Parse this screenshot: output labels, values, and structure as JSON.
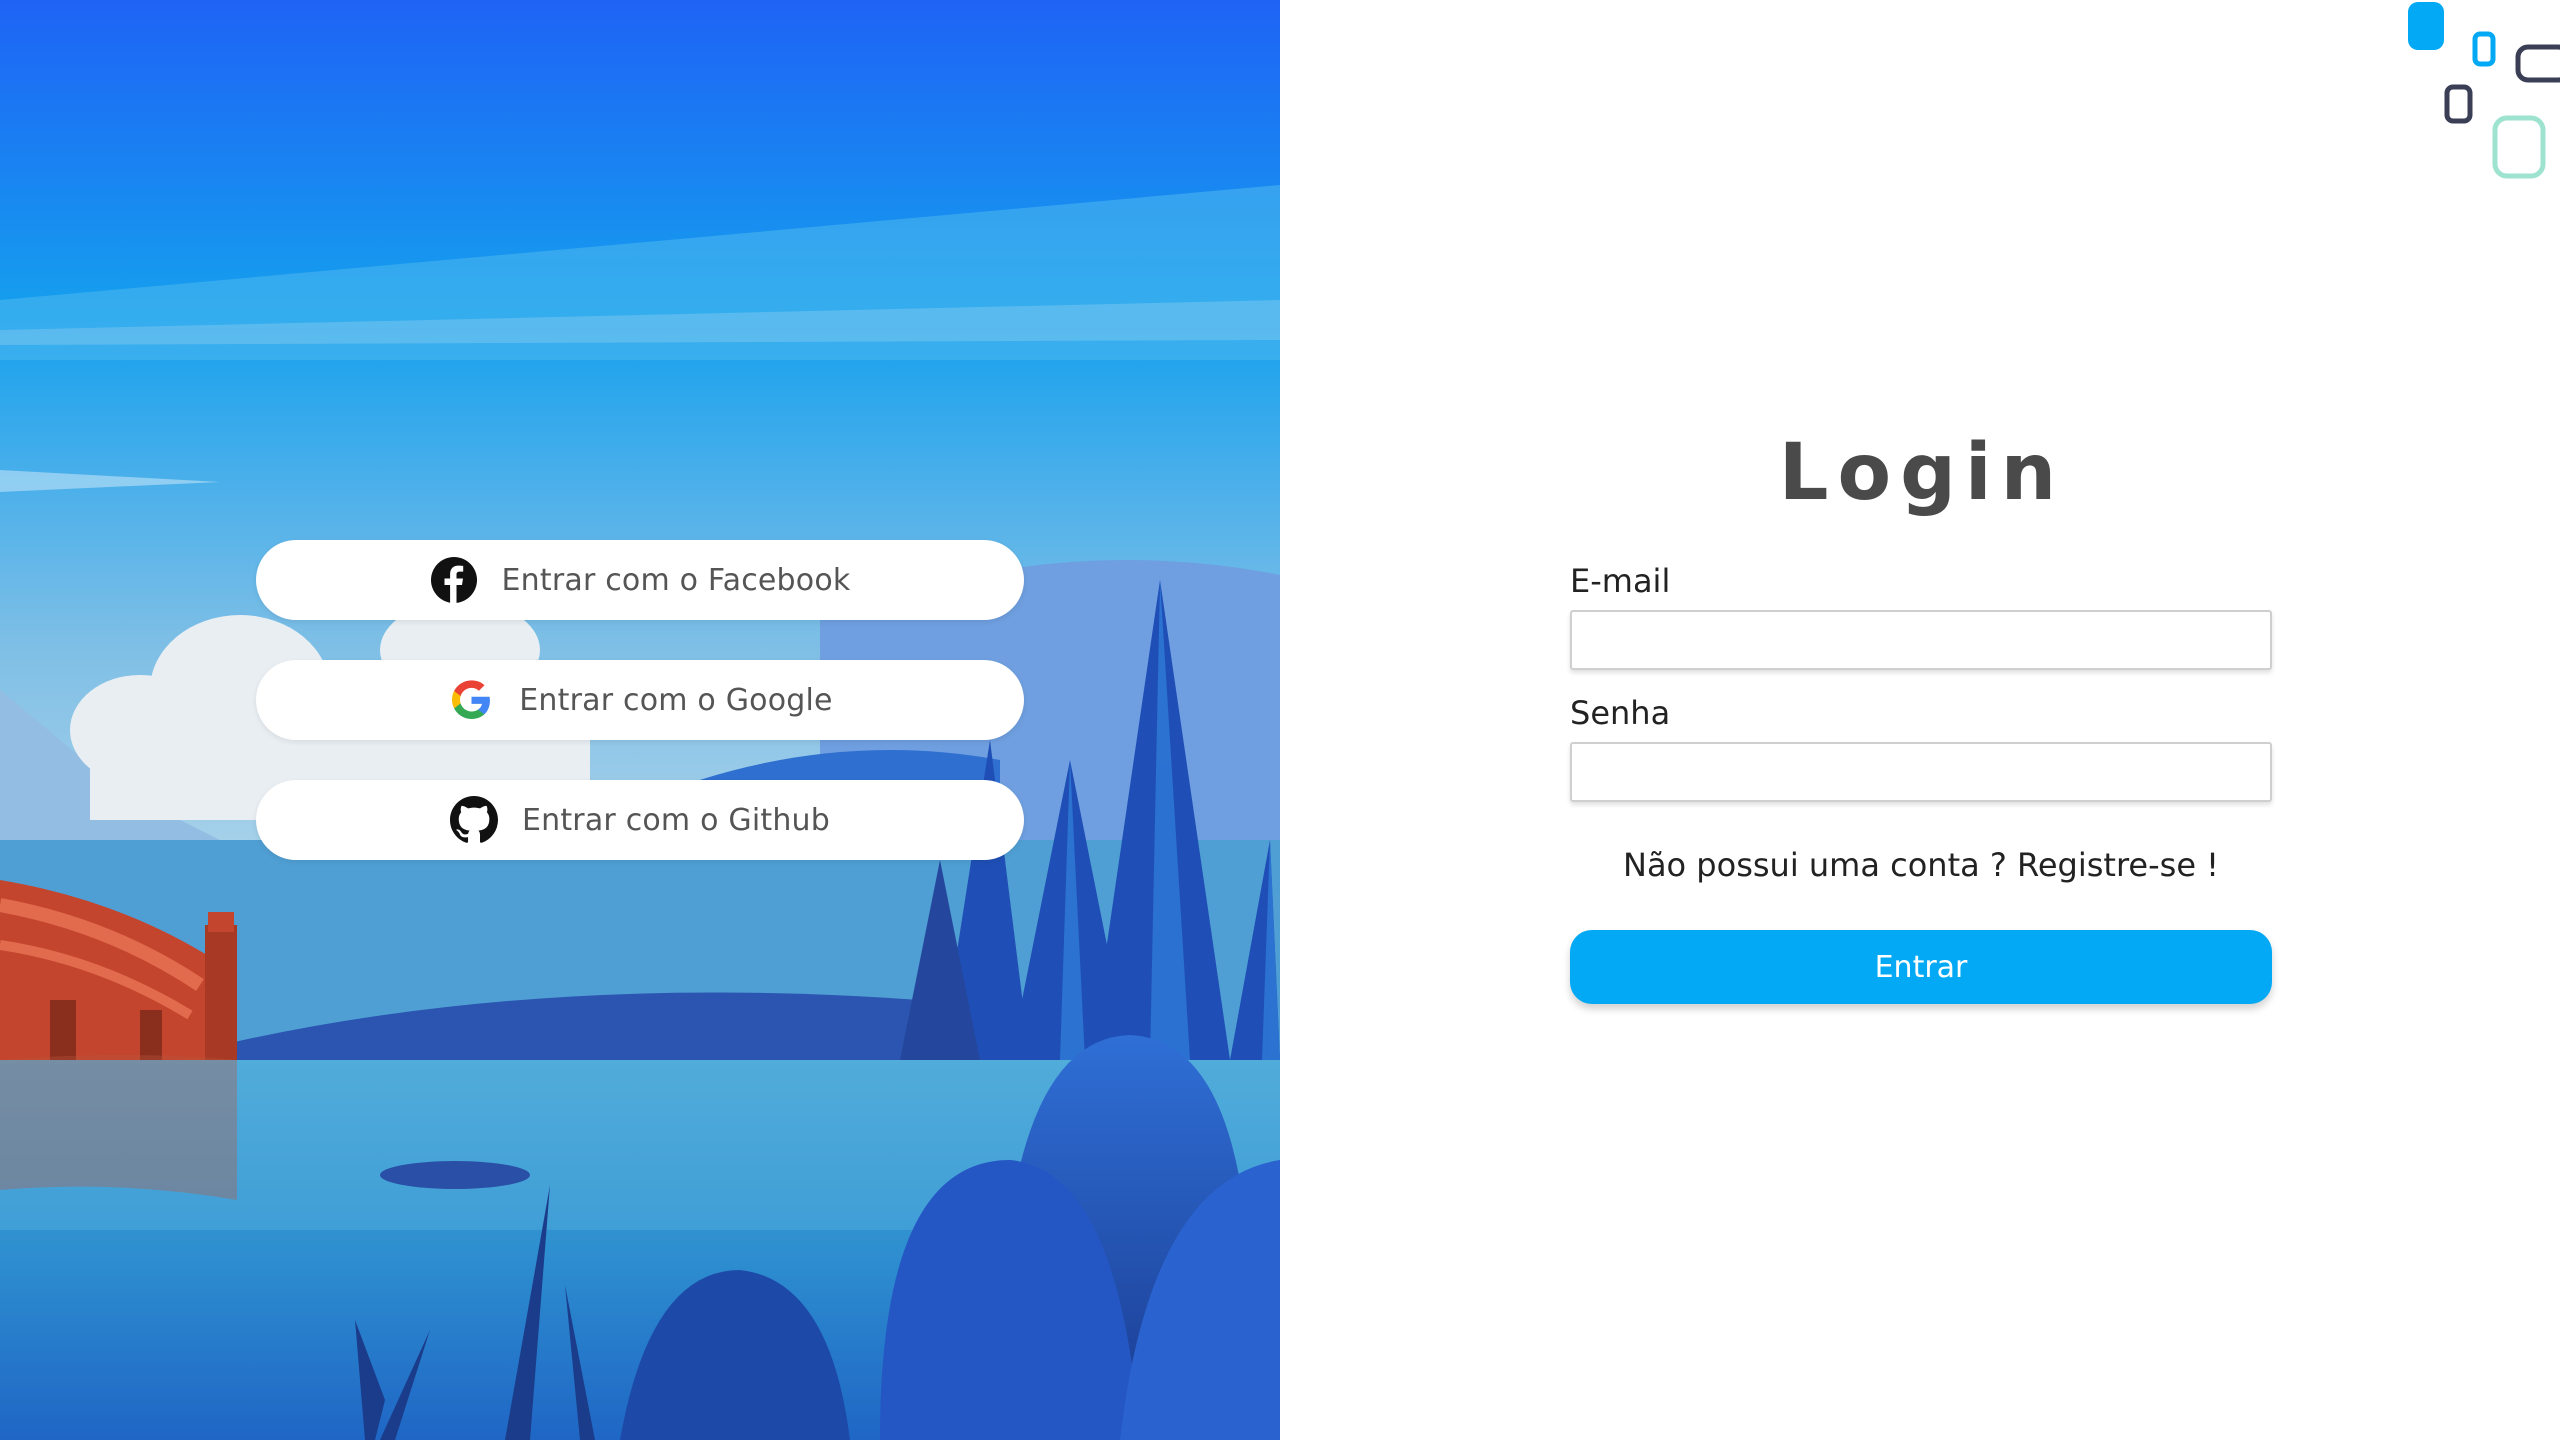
{
  "social": {
    "facebook_label": "Entrar com o Facebook",
    "google_label": "Entrar com o Google",
    "github_label": "Entrar com o Github"
  },
  "login": {
    "title": "Login",
    "email_label": "E-mail",
    "email_value": "",
    "senha_label": "Senha",
    "senha_value": "",
    "register_text": "Não possui uma conta ? Registre-se !",
    "submit_label": "Entrar"
  },
  "colors": {
    "accent": "#03a9f4",
    "sky_top": "#1e63f5",
    "title": "#4a4a4a",
    "decor_blue": "#03a9f4",
    "decor_dark": "#3a3f55",
    "decor_mint": "#9de3cf"
  },
  "icons": {
    "facebook": "facebook-icon",
    "google": "google-icon",
    "github": "github-icon"
  }
}
